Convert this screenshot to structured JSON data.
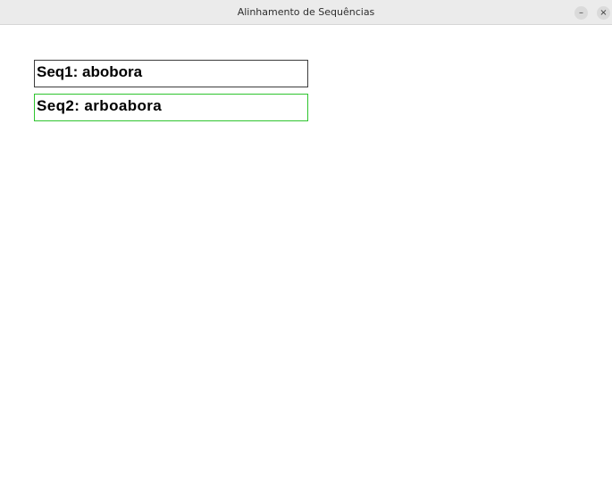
{
  "window": {
    "title": "Alinhamento de Sequências",
    "minimize_icon": "–",
    "close_icon": "×"
  },
  "sequences": [
    {
      "label": "Seq1: abobora",
      "border_color": "#3c3c3c"
    },
    {
      "label": "Seq2: arboabora",
      "border_color": "#2ec42e"
    }
  ]
}
